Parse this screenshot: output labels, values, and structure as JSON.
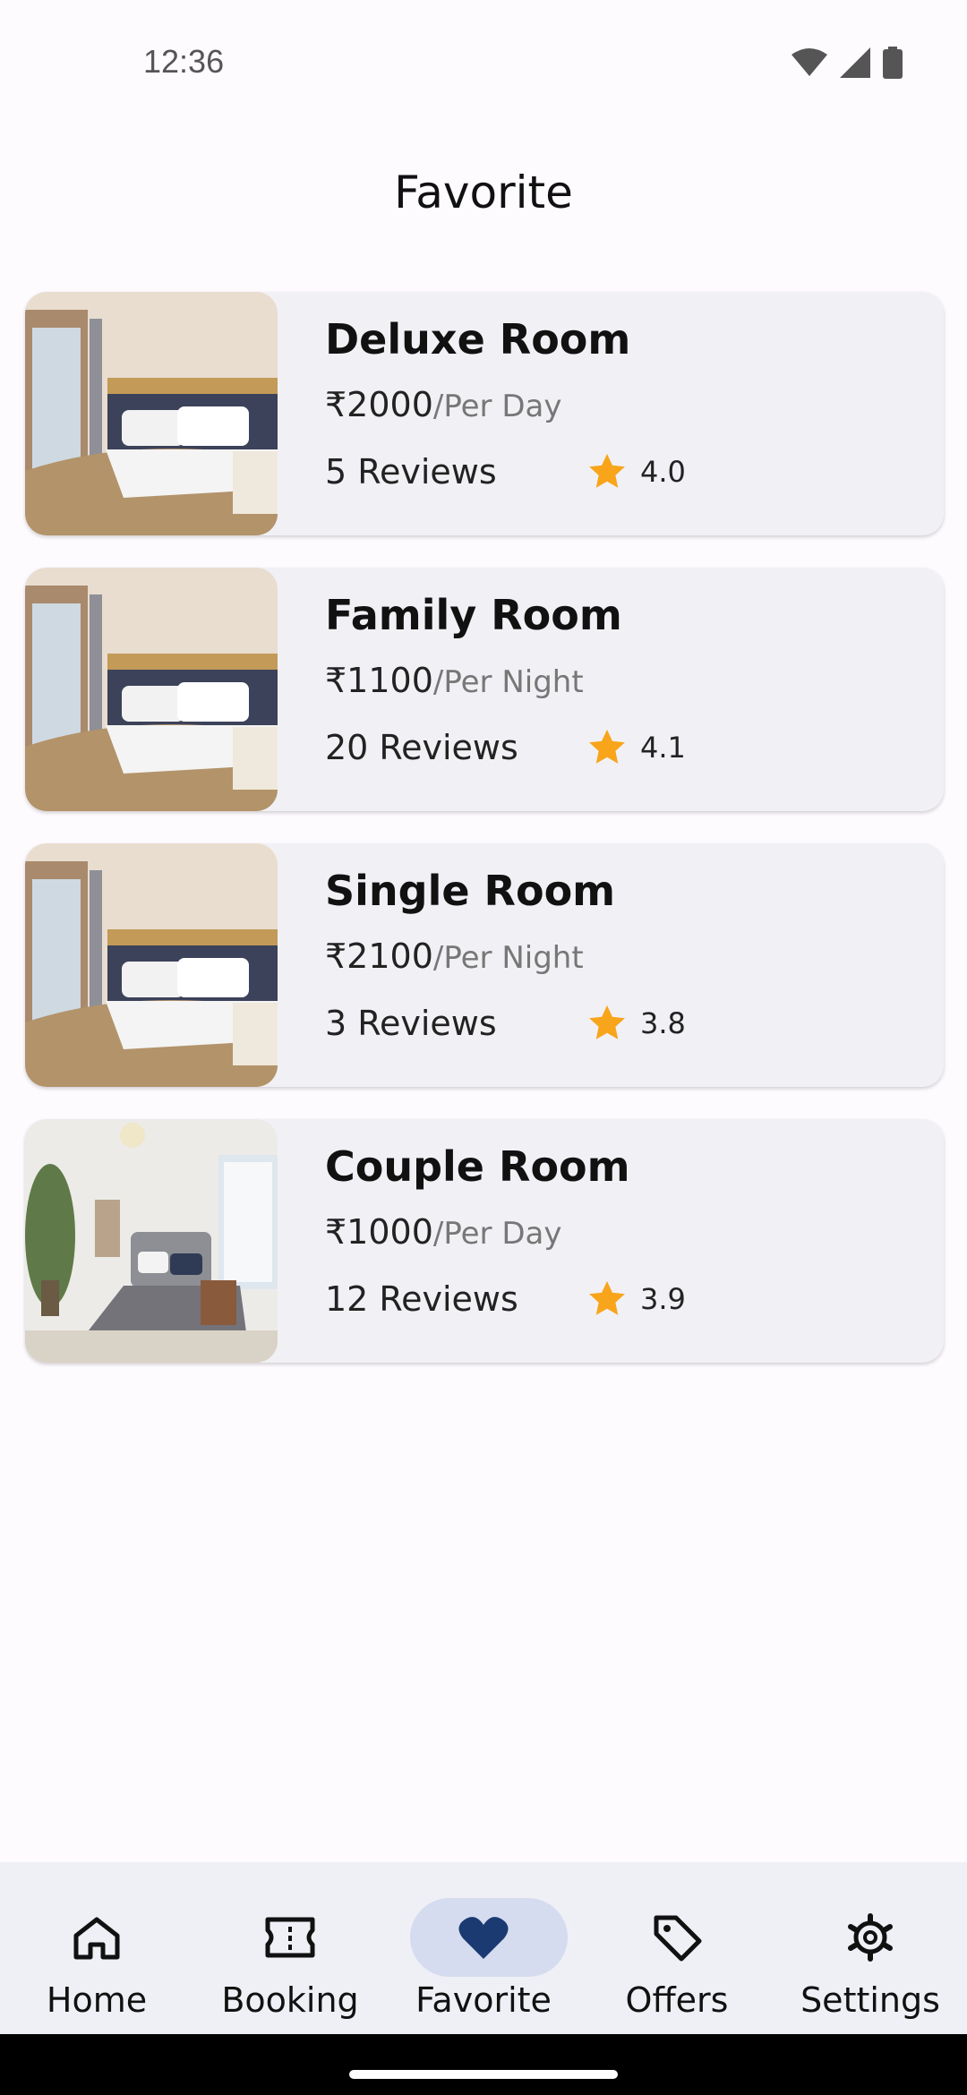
{
  "status_bar": {
    "time": "12:36"
  },
  "header": {
    "title": "Favorite"
  },
  "rooms": [
    {
      "name": "Deluxe Room",
      "price": "₹2000",
      "period": "/Per Day",
      "reviews": "5 Reviews",
      "rating": "4.0",
      "photo": "bedroom-dark-wall"
    },
    {
      "name": "Family Room",
      "price": "₹1100",
      "period": "/Per Night",
      "reviews": "20 Reviews",
      "rating": "4.1",
      "photo": "bedroom-dark-wall"
    },
    {
      "name": "Single Room",
      "price": "₹2100",
      "period": "/Per Night",
      "reviews": "3 Reviews",
      "rating": "3.8",
      "photo": "bedroom-dark-wall"
    },
    {
      "name": "Couple Room",
      "price": "₹1000",
      "period": "/Per Day",
      "reviews": "12 Reviews",
      "rating": "3.9",
      "photo": "bedroom-bright-window"
    }
  ],
  "bottom_nav": {
    "items": [
      {
        "label": "Home",
        "icon": "home-icon",
        "active": false
      },
      {
        "label": "Booking",
        "icon": "ticket-icon",
        "active": false
      },
      {
        "label": "Favorite",
        "icon": "heart-icon",
        "active": true
      },
      {
        "label": "Offers",
        "icon": "tag-icon",
        "active": false
      },
      {
        "label": "Settings",
        "icon": "gear-icon",
        "active": false
      }
    ]
  },
  "colors": {
    "star": "#f8a51c",
    "active_nav_pill": "#d6dcef",
    "active_icon": "#1b3a72",
    "card_bg": "#f1f1f5"
  }
}
